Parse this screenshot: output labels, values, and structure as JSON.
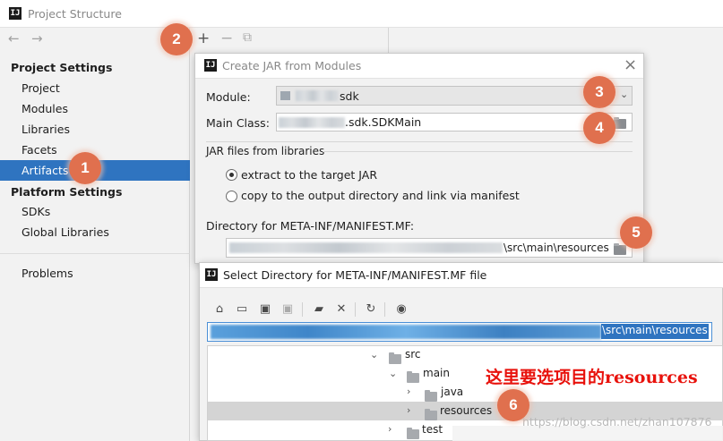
{
  "main_window": {
    "title": "Project Structure",
    "nav_back": "←",
    "nav_forward": "→",
    "toolbar": {
      "add": "+",
      "remove": "−",
      "copy": "⧉"
    }
  },
  "sidebar": {
    "project_settings_header": "Project Settings",
    "project_items": [
      "Project",
      "Modules",
      "Libraries",
      "Facets",
      "Artifacts"
    ],
    "platform_settings_header": "Platform Settings",
    "platform_items": [
      "SDKs",
      "Global Libraries"
    ],
    "problems": "Problems",
    "selected": "Artifacts"
  },
  "jar_dialog": {
    "title": "Create JAR from Modules",
    "close": "×",
    "module_label": "Module:",
    "module_value_suffix": "sdk",
    "main_class_label": "Main Class:",
    "main_class_value_suffix": ".sdk.SDKMain",
    "jar_files_section": "JAR files from libraries",
    "radio_extract": "extract to the target JAR",
    "radio_copy": "copy to the output directory and link via manifest",
    "directory_label": "Directory for META-INF/MANIFEST.MF:",
    "directory_value_suffix": "\\src\\main\\resources"
  },
  "select_dialog": {
    "title": "Select Directory for META-INF/MANIFEST.MF file",
    "path_value_suffix": "\\src\\main\\resources",
    "tree": [
      {
        "label": "src",
        "expanded": true
      },
      {
        "label": "main",
        "expanded": true
      },
      {
        "label": "java",
        "expanded": false
      },
      {
        "label": "resources",
        "expanded": false,
        "selected": true
      },
      {
        "label": "test",
        "expanded": false
      }
    ]
  },
  "annotations": {
    "badges": [
      "1",
      "2",
      "3",
      "4",
      "5",
      "6"
    ],
    "note": "这里要选项目的resources",
    "watermark": "https://blog.csdn.net/zhan107876"
  },
  "colors": {
    "selection": "#2f74c0",
    "badge": "#e0704e",
    "note_red": "#e8120c",
    "tree_selection": "#d4d4d4"
  }
}
